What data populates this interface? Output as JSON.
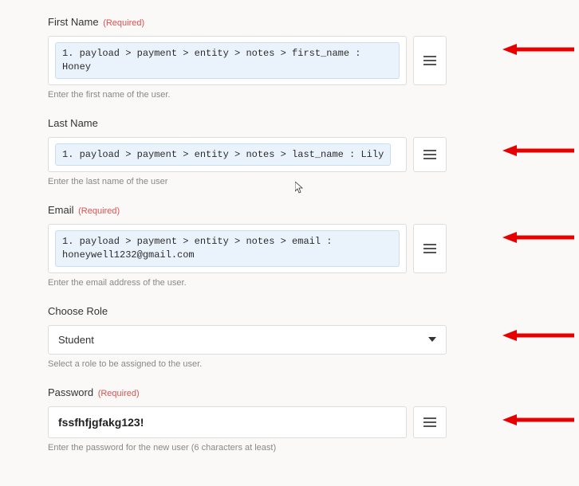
{
  "fields": {
    "first_name": {
      "label": "First Name",
      "required_text": "(Required)",
      "tag": "1. payload > payment > entity > notes > first_name : Honey",
      "help": "Enter the first name of the user."
    },
    "last_name": {
      "label": "Last Name",
      "tag": "1. payload > payment > entity > notes > last_name : Lily",
      "help": "Enter the last name of the user"
    },
    "email": {
      "label": "Email",
      "required_text": "(Required)",
      "tag": "1. payload > payment > entity > notes > email : honeywell1232@gmail.com",
      "help": "Enter the email address of the user."
    },
    "role": {
      "label": "Choose Role",
      "selected": "Student",
      "help": "Select a role to be assigned to the user."
    },
    "password": {
      "label": "Password",
      "required_text": "(Required)",
      "value": "fssfhfjgfakg123!",
      "help": "Enter the password for the new user (6 characters at least)"
    }
  }
}
